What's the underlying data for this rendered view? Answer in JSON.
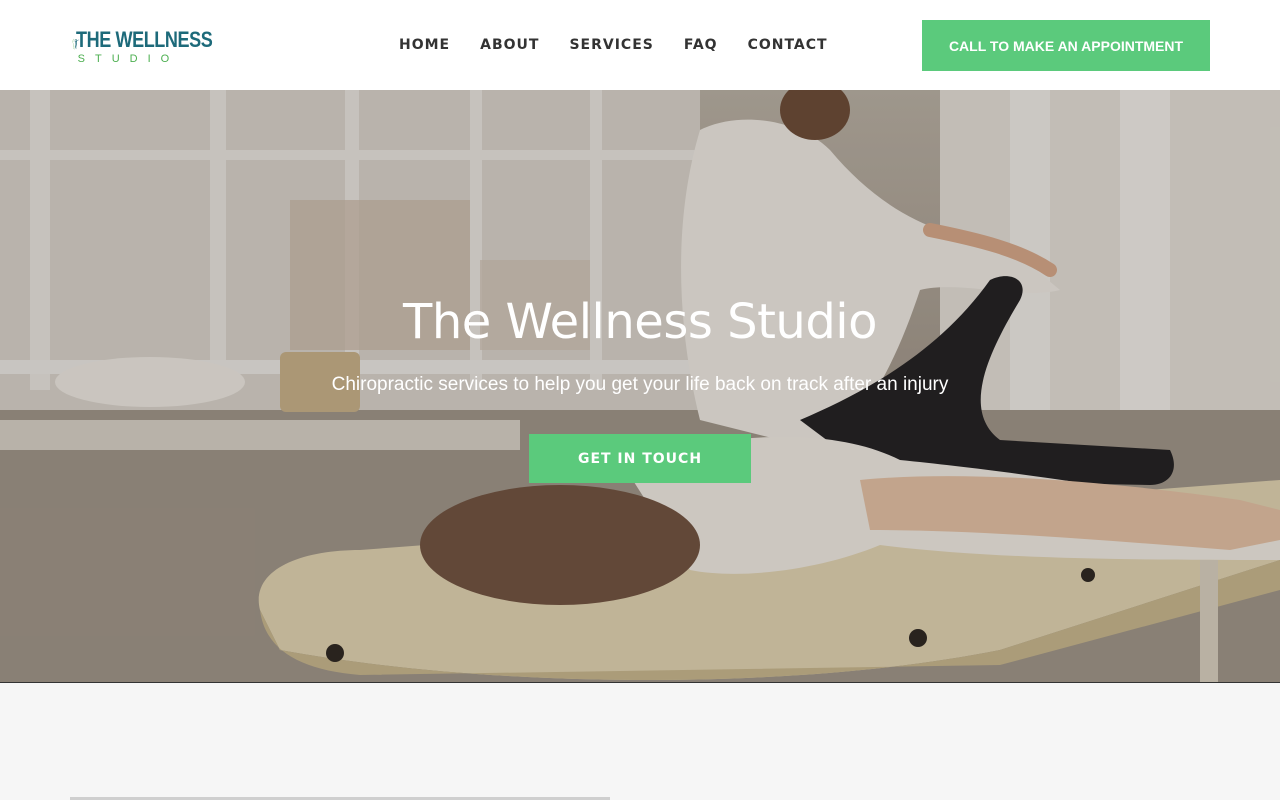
{
  "brand": {
    "name": "THE WELLNESS",
    "sub": "STUDIO",
    "colors": {
      "primary": "#1d6a7a",
      "accent": "#4caf50",
      "button": "#5bca7c"
    }
  },
  "nav": {
    "items": [
      {
        "label": "HOME"
      },
      {
        "label": "ABOUT"
      },
      {
        "label": "SERVICES"
      },
      {
        "label": "FAQ"
      },
      {
        "label": "CONTACT"
      }
    ]
  },
  "header_cta": {
    "label": "CALL TO MAKE AN APPOINTMENT"
  },
  "hero": {
    "title": "The Wellness Studio",
    "subtitle": "Chiropractic services to help you get your life back on track after an injury",
    "button_label": "GET IN TOUCH"
  }
}
